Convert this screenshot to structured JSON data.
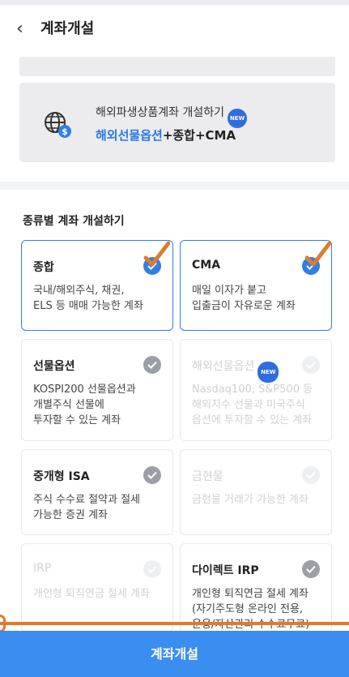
{
  "header": {
    "title": "계좌개설",
    "back_icon": "chevron-left-icon"
  },
  "promo": {
    "line1": "해외파생상품계좌 개설하기",
    "badge": "NEW",
    "line2_highlight": "해외선물옵션",
    "line2_rest": "+종합+CMA",
    "icon": "globe-dollar-icon"
  },
  "section": {
    "title": "종류별 계좌 개설하기"
  },
  "cards": [
    {
      "name": "종합",
      "desc": "국내/해외주식, 채권,\nELS 등 매매 가능한 계좌",
      "state": "selected"
    },
    {
      "name": "CMA",
      "desc": "매일 이자가 붙고\n입출금이 자유로운 계좌",
      "state": "selected"
    },
    {
      "name": "선물옵션",
      "desc": "KOSPI200 선물옵션과\n개별주식 선물에\n투자할 수 있는 계좌",
      "state": "available"
    },
    {
      "name": "해외선물옵션",
      "badge": "NEW",
      "desc": "Nasdaq100, S&P500 등\n해외지수 선물과 미국주식\n옵션에 투자할 수 있는 계좌",
      "state": "disabled"
    },
    {
      "name": "중개형 ISA",
      "desc": "주식 수수료 절약과 절세\n가능한 증권 계좌",
      "state": "available"
    },
    {
      "name": "금현물",
      "desc": "금현물 거래가 가능한 계좌",
      "state": "disabled"
    },
    {
      "name": "IRP",
      "desc": "개인형 퇴직연금 절세 계좌",
      "state": "disabled"
    },
    {
      "name": "다이렉트 IRP",
      "desc": "개인형 퇴직연금 절세 계좌\n(자기주도형 온라인 전용,\n운용/자산관리 수수료무료)",
      "state": "available"
    }
  ],
  "footer": {
    "button_label": "계좌개설"
  },
  "colors": {
    "accent": "#2f7fe6",
    "button": "#3a8ef0",
    "annotation": "#e07a2c"
  }
}
